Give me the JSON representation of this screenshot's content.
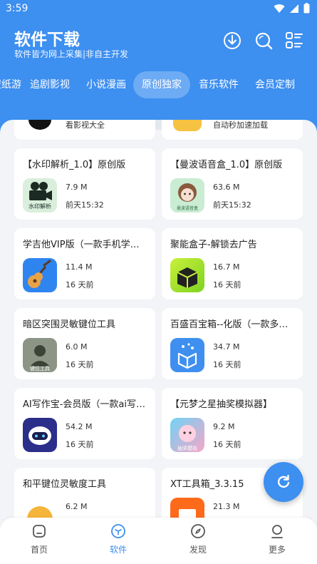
{
  "status_bar": {
    "time": "3:59"
  },
  "header": {
    "title": "软件下载",
    "subtitle": "软件皆为网上采集|非自主开发"
  },
  "tabs": [
    {
      "label": "壁纸游"
    },
    {
      "label": "追剧影视"
    },
    {
      "label": "小说漫画"
    },
    {
      "label": "原创独家",
      "active": true
    },
    {
      "label": "音乐软件"
    },
    {
      "label": "会员定制"
    }
  ],
  "partial_row": [
    {
      "date": "看影视大全"
    },
    {
      "date": "自动秒加速加载"
    }
  ],
  "apps": [
    {
      "name": "【水印解析_1.0】原创版",
      "size": "7.9 M",
      "date": "前天15:32",
      "icon": "film-camera-icon",
      "icon_text": "水印解析"
    },
    {
      "name": "【曼波语音盒_1.0】原创版",
      "size": "63.6 M",
      "date": "前天15:32",
      "icon": "anime-girl-icon",
      "icon_text": "曼波语音盒"
    },
    {
      "name": "学吉他VIP版（一款手机学吉他）",
      "size": "11.4 M",
      "date": "16 天前",
      "icon": "guitar-icon"
    },
    {
      "name": "聚能盒子-解锁去广告",
      "size": "16.7 M",
      "date": "16 天前",
      "icon": "box-icon"
    },
    {
      "name": "暗区突围灵敏键位工具",
      "size": "6.0 M",
      "date": "16 天前",
      "icon": "soldier-icon",
      "icon_text": "键位工具"
    },
    {
      "name": "百盛百宝箱--化版（一款多功能工具）",
      "size": "34.7 M",
      "date": "16 天前",
      "icon": "toolbox-icon"
    },
    {
      "name": "AI写作宝-会员版（一款ai写作）",
      "size": "54.2 M",
      "date": "16 天前",
      "icon": "robot-icon"
    },
    {
      "name": "【元梦之星抽奖模拟器】",
      "size": "9.2 M",
      "date": "16 天前",
      "icon": "game-character-icon",
      "icon_text": "抽奖模拟"
    },
    {
      "name": "和平键位灵敏度工具",
      "size": "6.2 M",
      "date": "",
      "icon": "angry-face-icon"
    },
    {
      "name": "XT工具箱_3.3.15",
      "size": "21.3 M",
      "date": "",
      "icon": "orange-toolbox-icon"
    }
  ],
  "bottom_nav": [
    {
      "label": "首页",
      "icon": "home-icon"
    },
    {
      "label": "软件",
      "icon": "cube-icon",
      "active": true
    },
    {
      "label": "发现",
      "icon": "compass-icon"
    },
    {
      "label": "更多",
      "icon": "person-icon"
    }
  ],
  "colors": {
    "primary": "#3d8ff0",
    "background": "#f2f4f7",
    "card": "#ffffff"
  }
}
